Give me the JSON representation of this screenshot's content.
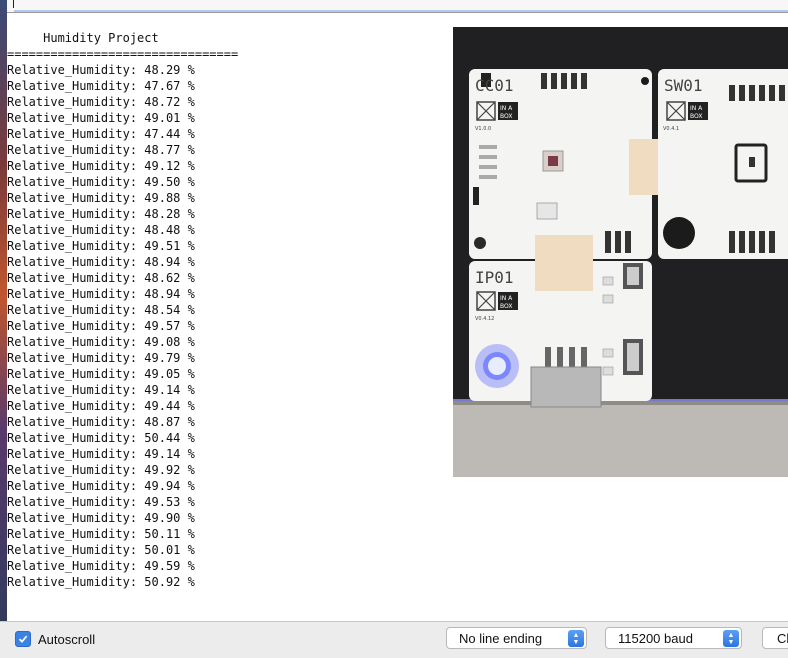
{
  "serial_monitor": {
    "input_value": "",
    "title_line": "     Humidity Project",
    "separator_line": "================================",
    "reading_prefix": "Relative_Humidity: ",
    "reading_unit": " %",
    "readings": [
      "48.29",
      "47.67",
      "48.72",
      "49.01",
      "47.44",
      "48.77",
      "49.12",
      "49.50",
      "49.88",
      "48.28",
      "48.48",
      "49.51",
      "48.94",
      "48.62",
      "48.94",
      "48.54",
      "49.57",
      "49.08",
      "49.79",
      "49.05",
      "49.14",
      "49.44",
      "48.87",
      "50.44",
      "49.14",
      "49.92",
      "49.94",
      "49.53",
      "49.90",
      "50.11",
      "50.01",
      "49.59",
      "50.92"
    ]
  },
  "photo": {
    "labels": {
      "cc01": "CC01",
      "sw01": "SW01",
      "ip01": "IP01",
      "brand": "IN A",
      "brand2": "BOX",
      "ver_cc01": "V1.0.0",
      "ver_sw01": "V0.4.1",
      "ver_ip01": "V0.4.12"
    },
    "colors": {
      "board": "#f4f4f2",
      "backdrop": "#1b1b1c",
      "led": "#4a5cff"
    }
  },
  "bottom_bar": {
    "autoscroll_label": "Autoscroll",
    "autoscroll_checked": true,
    "line_ending": "No line ending",
    "baud": "115200 baud",
    "clear_label": "Cl"
  },
  "colors": {
    "accent": "#3b82e6"
  }
}
